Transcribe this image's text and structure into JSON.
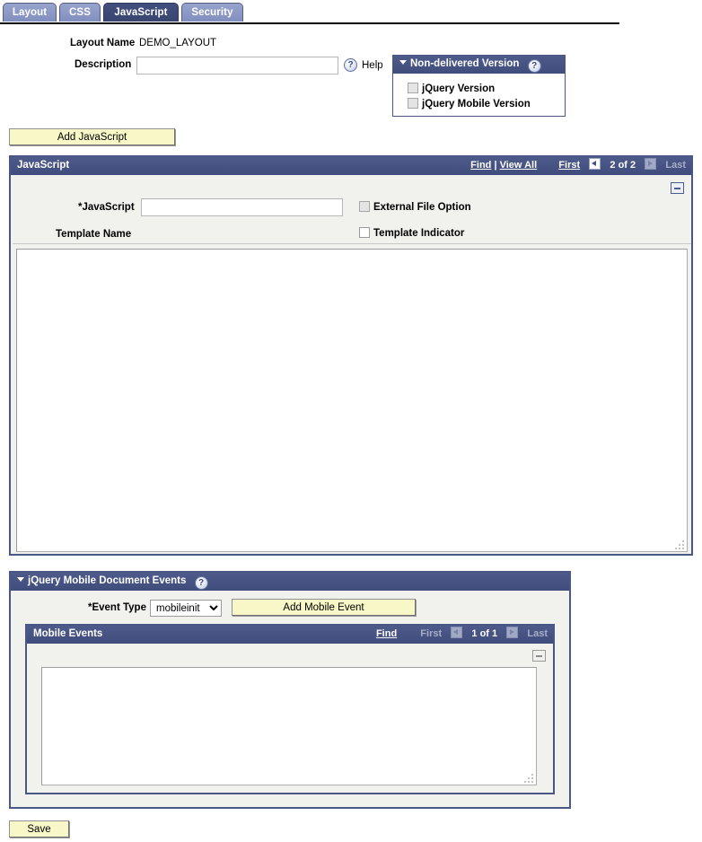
{
  "tabs": [
    {
      "label": "Layout",
      "active": false
    },
    {
      "label": "CSS",
      "active": false
    },
    {
      "label": "JavaScript",
      "active": true
    },
    {
      "label": "Security",
      "active": false
    }
  ],
  "form": {
    "layout_name_label": "Layout Name",
    "layout_name_value": "DEMO_LAYOUT",
    "description_label": "Description",
    "description_value": "",
    "description_placeholder": "",
    "help_icon": "question-mark-icon",
    "help_label": "Help"
  },
  "non_delivered_version": {
    "title": "Non-delivered Version",
    "collapse_icon": "caret-down-icon",
    "help_icon": "question-mark-icon",
    "options": [
      {
        "label": "jQuery Version",
        "checked": false
      },
      {
        "label": "jQuery Mobile Version",
        "checked": false
      }
    ]
  },
  "add_javascript_button": "Add JavaScript",
  "javascript_section": {
    "title": "JavaScript",
    "find_label": "Find",
    "separator": "|",
    "view_all_label": "View All",
    "first_label": "First",
    "prev_icon": "left-arrow-icon",
    "counter": "2 of 2",
    "next_icon": "right-arrow-icon",
    "last_label": "Last",
    "collapse_icon": "minus-icon",
    "javascript_field_label": "*JavaScript",
    "javascript_field_value": "",
    "template_name_label": "Template Name",
    "template_name_value": "",
    "external_file_option_label": "External File Option",
    "external_file_option_checked": false,
    "template_indicator_label": "Template Indicator",
    "template_indicator_checked": false,
    "resize_grip_icon": "resize-grip-icon"
  },
  "mobile_section": {
    "title": "jQuery Mobile Document Events",
    "collapse_icon": "caret-down-icon",
    "help_icon": "question-mark-icon",
    "event_type_label": "*Event Type",
    "event_type_value": "mobileinit",
    "event_type_options": [
      "mobileinit"
    ],
    "add_mobile_event_button": "Add Mobile Event",
    "grid": {
      "title": "Mobile Events",
      "find_label": "Find",
      "first_label": "First",
      "prev_icon": "left-arrow-icon",
      "counter": "1 of 1",
      "next_icon": "right-arrow-icon",
      "last_label": "Last",
      "collapse_icon": "minus-icon",
      "textarea_value": "",
      "resize_grip_icon": "resize-grip-icon"
    }
  },
  "save_button": "Save",
  "colors": {
    "header_navy": "#454f80",
    "tab_inactive": "#8e9cc8",
    "tab_active": "#3d4a7a",
    "button_yellow": "#f7f7c8",
    "panel_grey": "#f1f2ee"
  }
}
